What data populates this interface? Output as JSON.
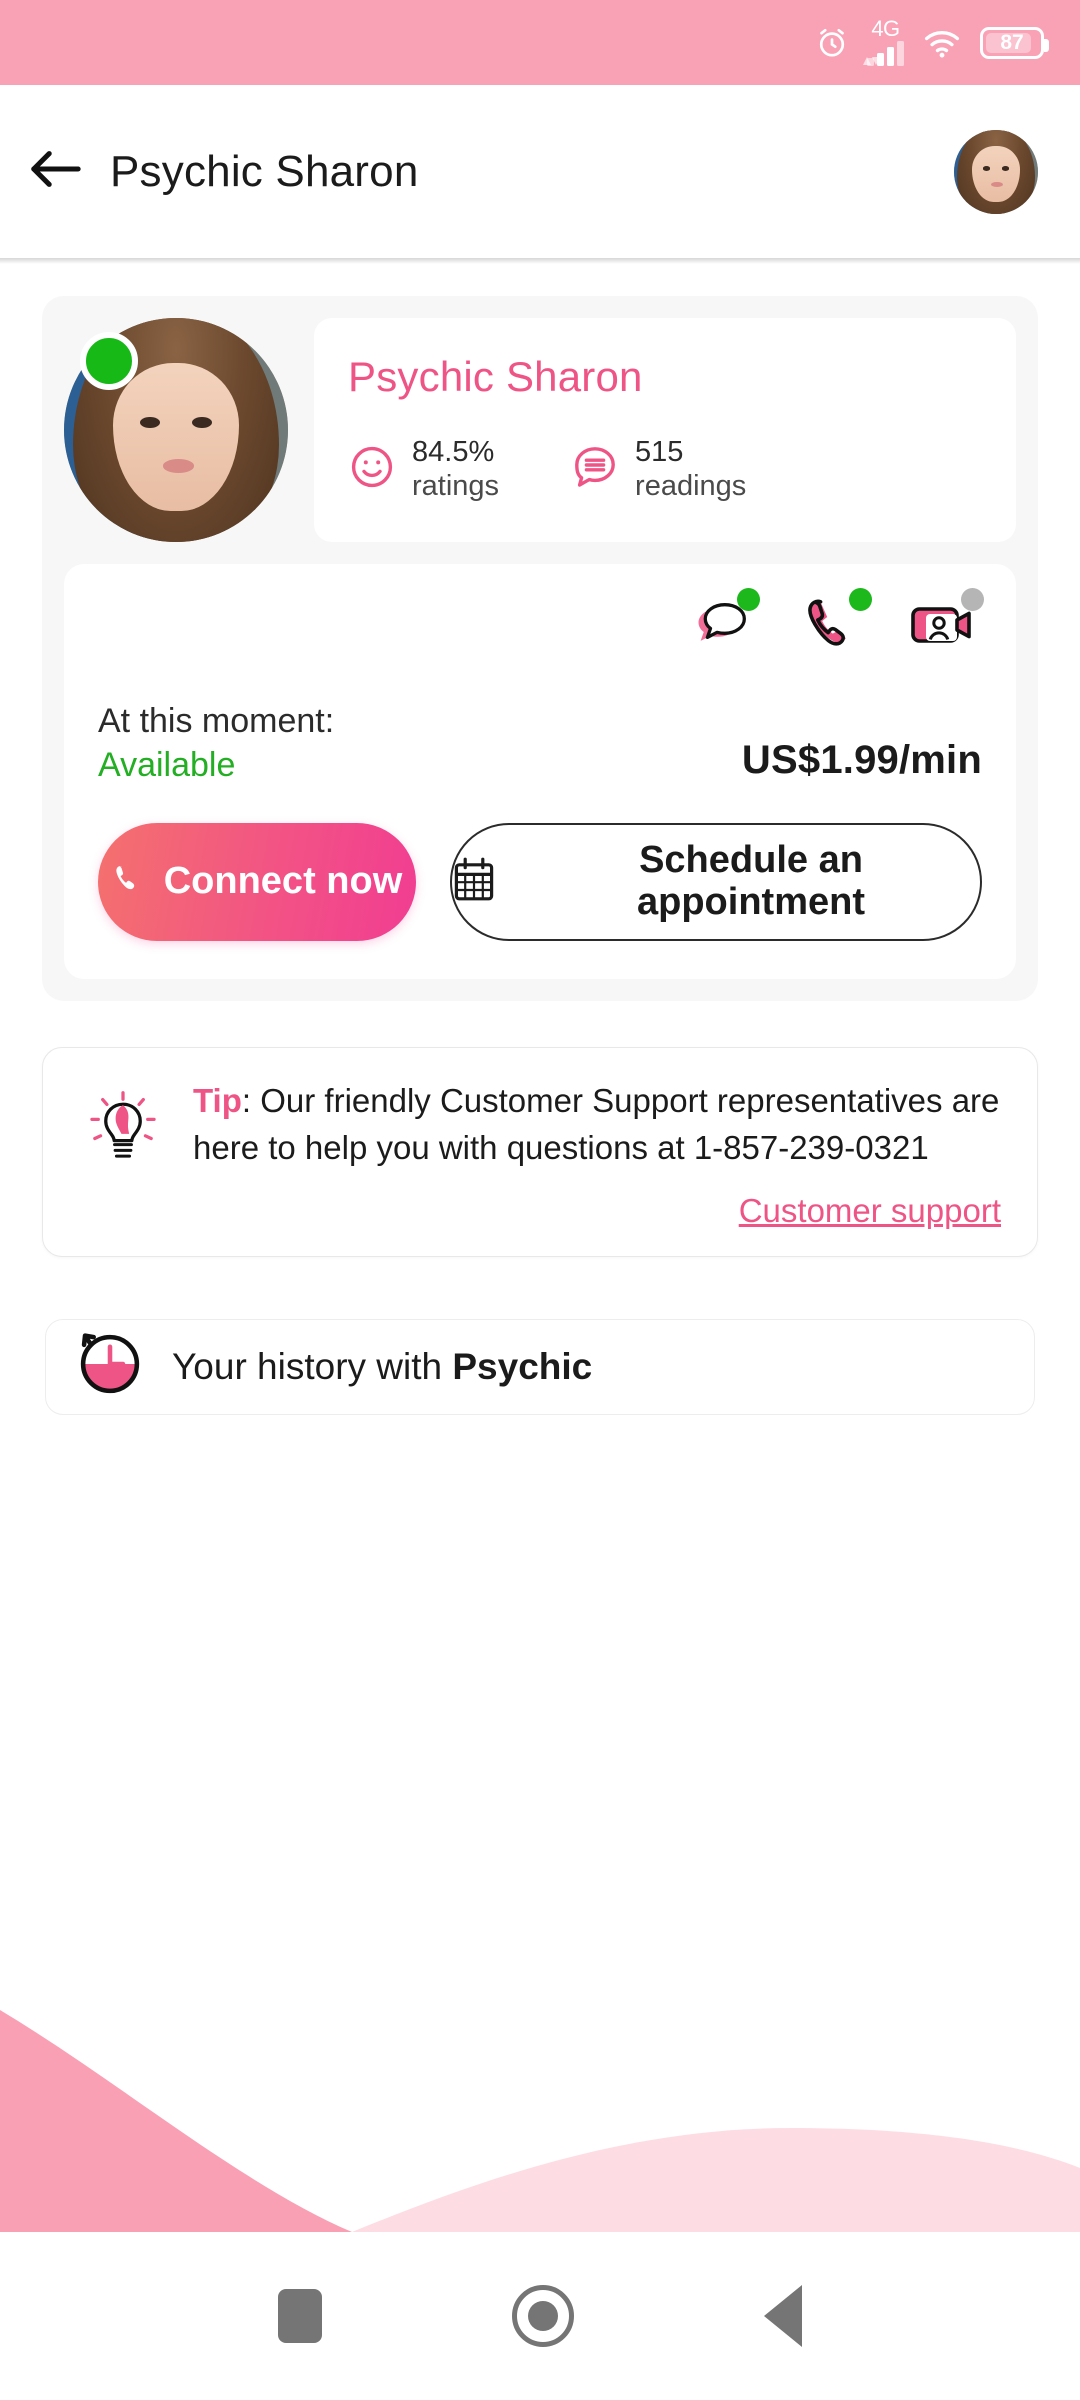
{
  "status_bar": {
    "alarm_icon": "alarm-clock-icon",
    "network_label": "4G",
    "signal_icon": "signal-bars-icon",
    "wifi_icon": "wifi-icon",
    "battery_level": "87",
    "battery_icon": "battery-icon",
    "background_color": "#F9A2B5"
  },
  "app_bar": {
    "back_icon": "back-arrow-icon",
    "title": "Psychic Sharon",
    "avatar_name": "user-avatar"
  },
  "profile": {
    "name": "Psychic Sharon",
    "online_status": "online",
    "avatar_name": "psychic-avatar",
    "stats": [
      {
        "icon": "smiley-face-icon",
        "value": "84.5%",
        "label": "ratings"
      },
      {
        "icon": "chat-lines-icon",
        "value": "515",
        "label": "readings"
      }
    ]
  },
  "availability": {
    "channels": [
      {
        "icon": "chat-bubble-icon",
        "name": "chat",
        "status": "available",
        "dot_color": "#1CB81C"
      },
      {
        "icon": "phone-handset-icon",
        "name": "phone",
        "status": "available",
        "dot_color": "#1CB81C"
      },
      {
        "icon": "video-camera-icon",
        "name": "video",
        "status": "unavailable",
        "dot_color": "#B5B5B5"
      }
    ],
    "moment_label": "At this moment:",
    "status_text": "Available",
    "status_color": "#23AE23",
    "price": "US$1.99/min",
    "connect_button": {
      "label": "Connect now",
      "icon": "phone-handset-icon"
    },
    "schedule_button": {
      "label": "Schedule an appointment",
      "icon": "calendar-icon"
    }
  },
  "tip": {
    "icon": "lightbulb-icon",
    "prefix": "Tip",
    "body": ": Our friendly Customer Support representatives are here to help you with questions at 1-857-239-0321",
    "phone": "1-857-239-0321",
    "link_label": "Customer support"
  },
  "history": {
    "icon": "clock-history-icon",
    "title_prefix": "Your history with ",
    "title_bold": "Psychic"
  },
  "nav_bar": {
    "recents_icon": "square-recents-icon",
    "home_icon": "circle-home-icon",
    "back_icon": "triangle-back-icon"
  },
  "theme": {
    "brand_pink": "#EE5586",
    "status_pink": "#F9A2B5",
    "wave_dark": "#FAA0B5",
    "wave_light": "#FDDDE3",
    "green": "#16B916"
  }
}
